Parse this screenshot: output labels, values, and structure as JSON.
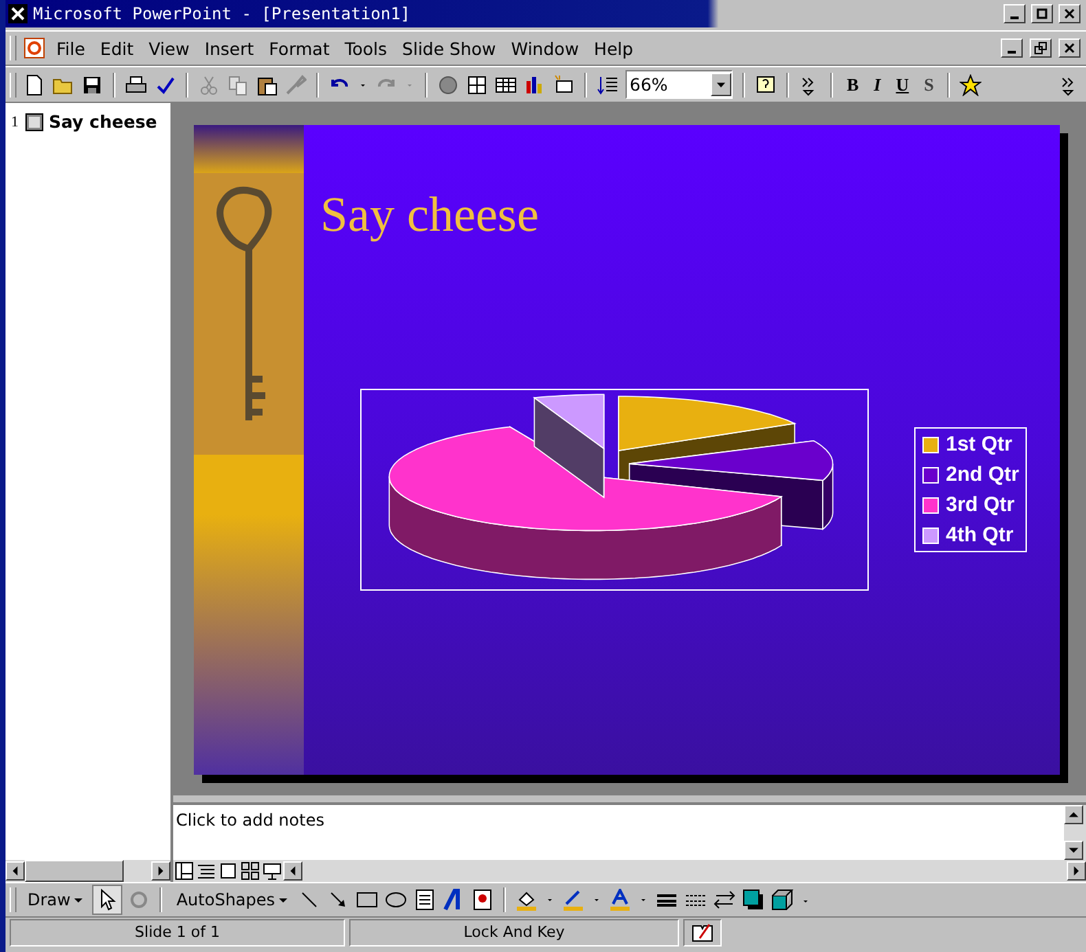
{
  "window": {
    "title": "Microsoft PowerPoint - [Presentation1]"
  },
  "menu": [
    "File",
    "Edit",
    "View",
    "Insert",
    "Format",
    "Tools",
    "Slide Show",
    "Window",
    "Help"
  ],
  "toolbar": {
    "zoom": "66%",
    "format_buttons": [
      "B",
      "I",
      "U",
      "S"
    ]
  },
  "outline": {
    "slides": [
      {
        "number": "1",
        "title": "Say cheese"
      }
    ]
  },
  "slide": {
    "title": "Say cheese",
    "legend": [
      {
        "label": "1st Qtr",
        "color": "#e8b010"
      },
      {
        "label": "2nd Qtr",
        "color": "#6a00cc"
      },
      {
        "label": "3rd Qtr",
        "color": "#ff33cc"
      },
      {
        "label": "4th Qtr",
        "color": "#cc99ff"
      }
    ]
  },
  "notes": {
    "placeholder": "Click to add notes"
  },
  "drawing_toolbar": {
    "draw": "Draw",
    "autoshapes": "AutoShapes"
  },
  "status_bar": [
    "Slide 1 of 1",
    "Lock And Key"
  ]
}
